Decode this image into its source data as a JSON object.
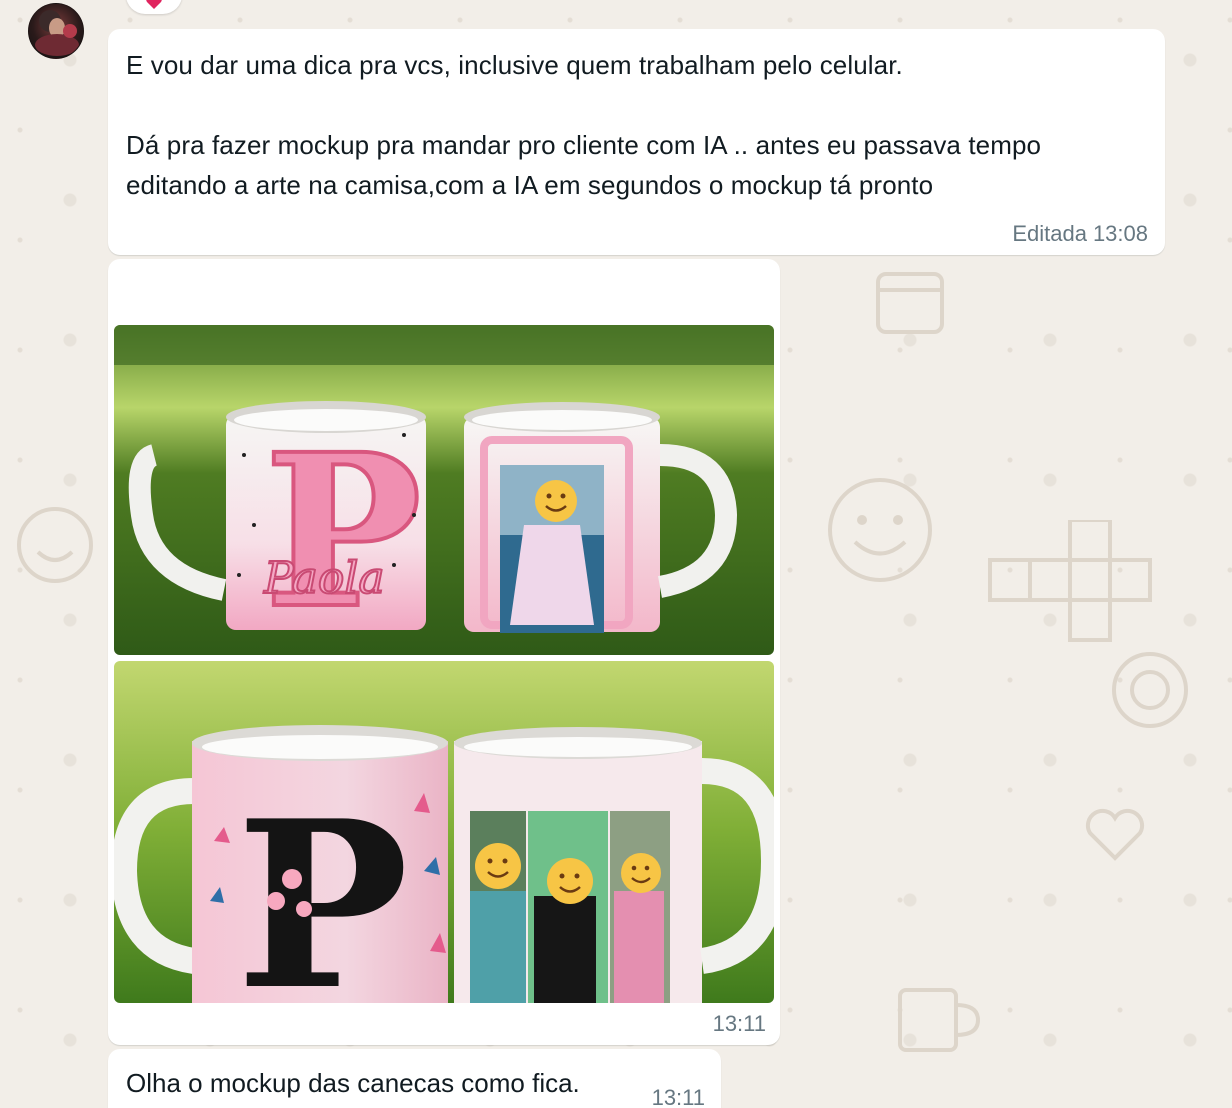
{
  "chat": {
    "messages": [
      {
        "text": "E vou dar uma dica pra vcs, inclusive quem trabalham pelo celular.\n\nDá pra fazer mockup pra mandar pro cliente com IA .. antes eu passava tempo editando a arte na camisa,com a IA em segundos o mockup tá pronto",
        "edited_label": "Editada",
        "time": "13:08"
      },
      {
        "type": "images",
        "mug_text": "Paola",
        "time": "13:11"
      },
      {
        "text": "Olha o mockup das canecas como fica.",
        "time": "13:11"
      }
    ]
  },
  "icons": {
    "reaction": "heart-icon",
    "emoji": "smiling-face-emoji"
  },
  "colors": {
    "bubble": "#ffffff",
    "meta_text": "#667781",
    "wallpaper": "#efeae2",
    "reaction_heart": "#e0245e"
  }
}
